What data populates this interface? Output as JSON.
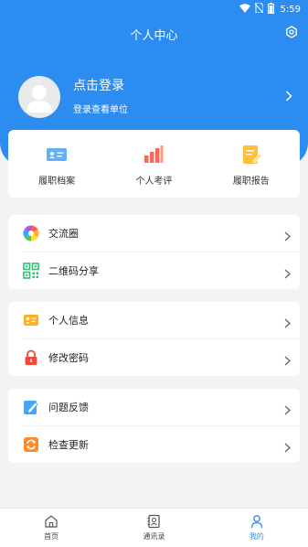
{
  "status_bar": {
    "time": "5:59"
  },
  "header": {
    "title": "个人中心"
  },
  "profile": {
    "login_text": "点击登录",
    "sub_text": "登录查看单位"
  },
  "quick_actions": [
    {
      "label": "履职档案",
      "icon": "id-card-icon"
    },
    {
      "label": "个人考评",
      "icon": "bar-chart-icon"
    },
    {
      "label": "履职报告",
      "icon": "report-edit-icon"
    }
  ],
  "menu_groups": [
    {
      "items": [
        {
          "label": "交流圈",
          "icon": "aperture-icon"
        },
        {
          "label": "二维码分享",
          "icon": "qrcode-icon"
        }
      ]
    },
    {
      "items": [
        {
          "label": "个人信息",
          "icon": "user-card-icon"
        },
        {
          "label": "修改密码",
          "icon": "lock-icon"
        }
      ]
    },
    {
      "items": [
        {
          "label": "问题反馈",
          "icon": "feedback-pen-icon"
        },
        {
          "label": "检查更新",
          "icon": "refresh-icon"
        }
      ]
    }
  ],
  "tabbar": [
    {
      "label": "首页",
      "icon": "home-icon"
    },
    {
      "label": "通讯录",
      "icon": "contacts-icon"
    },
    {
      "label": "我的",
      "icon": "person-icon",
      "active": true
    }
  ],
  "colors": {
    "primary": "#2d8cf0",
    "background": "#f2f3f5"
  }
}
